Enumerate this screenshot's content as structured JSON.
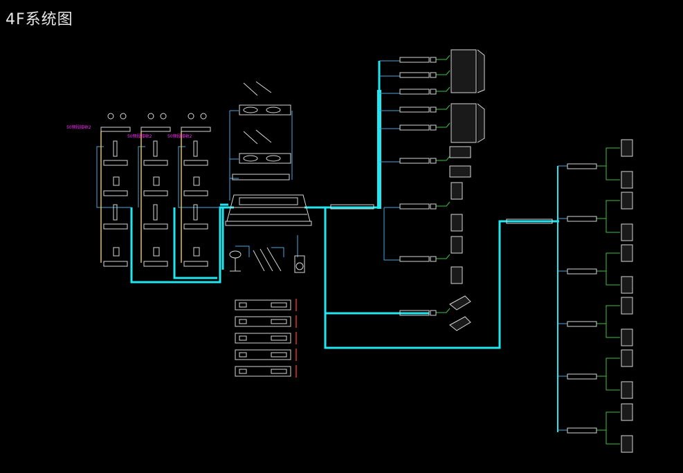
{
  "title": "4F系统图",
  "colors": {
    "background": "#000000",
    "trunk": "#22e6f0",
    "wire": "#4aa8e0",
    "green": "#3ec43e",
    "yellow": "#e8c23a",
    "red": "#e03030",
    "equipment": "#d8d8d8",
    "annotation": "#ff2bff"
  },
  "wireless_groups": [
    {
      "label": "50频段接收2"
    },
    {
      "label": "50频段接收2"
    },
    {
      "label": "50频段接收2"
    }
  ],
  "amp_column_top_count": 10,
  "amp_column_right_count": 6,
  "rack_unit_count": 5
}
